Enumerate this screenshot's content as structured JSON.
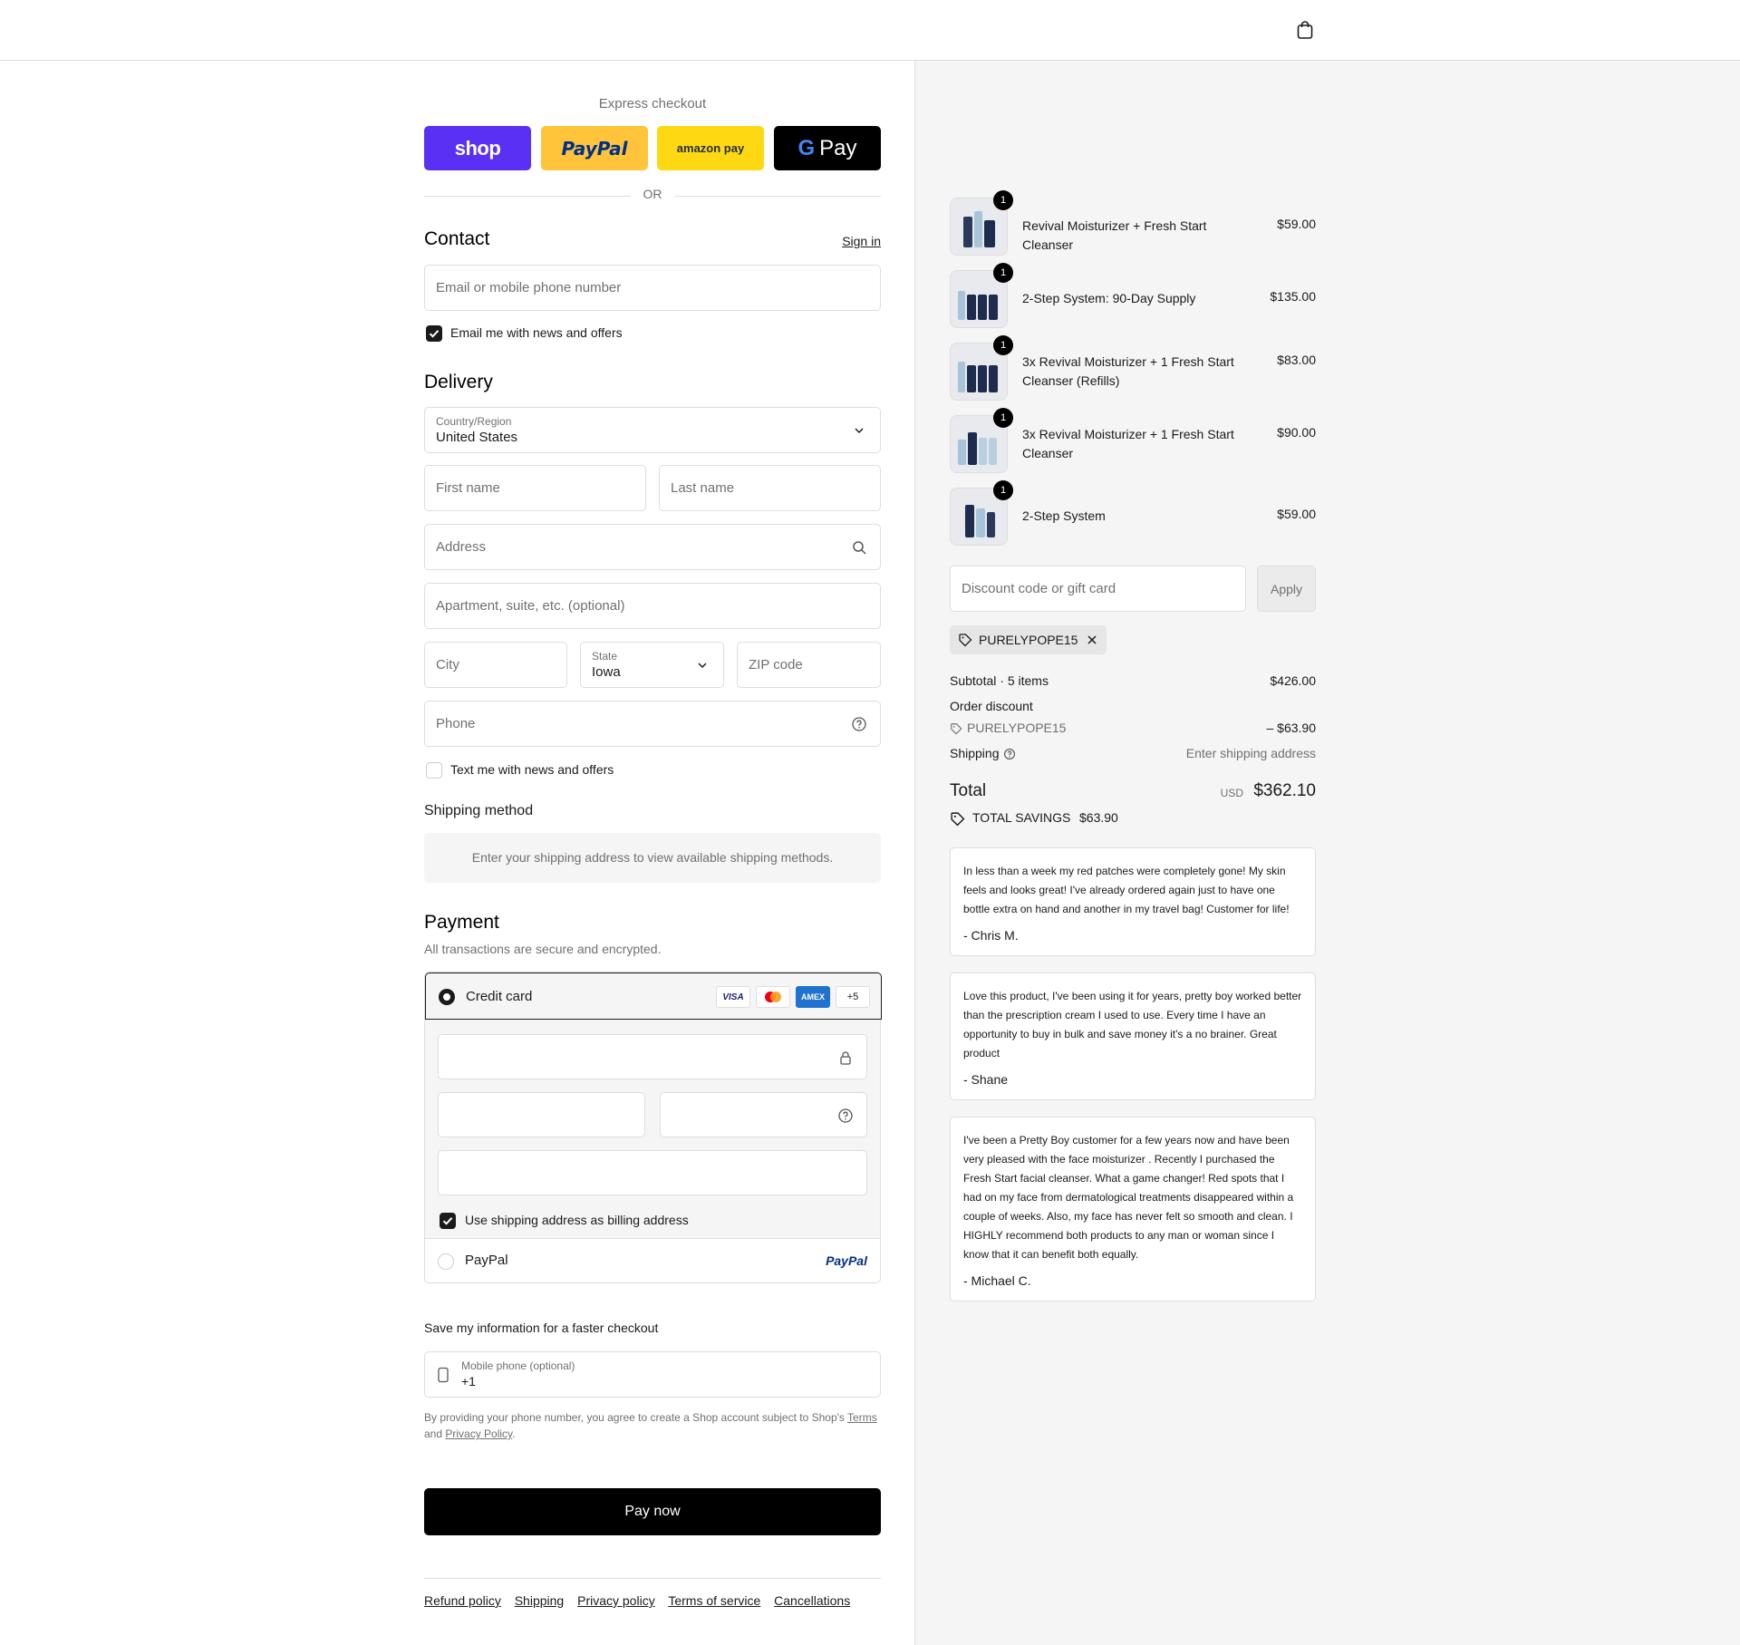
{
  "express": {
    "title": "Express checkout",
    "shop_label": "shop",
    "paypal_label": "PayPal",
    "amazon_label": "amazon pay",
    "gpay_label": "Pay",
    "or_label": "OR"
  },
  "contact": {
    "title": "Contact",
    "sign_in": "Sign in",
    "email_placeholder": "Email or mobile phone number",
    "news_label": "Email me with news and offers"
  },
  "delivery": {
    "title": "Delivery",
    "country_label": "Country/Region",
    "country_value": "United States",
    "first_name_placeholder": "First name",
    "last_name_placeholder": "Last name",
    "address_placeholder": "Address",
    "apartment_placeholder": "Apartment, suite, etc. (optional)",
    "city_placeholder": "City",
    "state_label": "State",
    "state_value": "Iowa",
    "zip_placeholder": "ZIP code",
    "phone_placeholder": "Phone",
    "text_label": "Text me with news and offers"
  },
  "shipping_method": {
    "title": "Shipping method",
    "message": "Enter your shipping address to view available shipping methods."
  },
  "payment": {
    "title": "Payment",
    "subtitle": "All transactions are secure and encrypted.",
    "credit_card_label": "Credit card",
    "card_brands": [
      "VISA",
      "MC",
      "AMEX",
      "+5"
    ],
    "billing_label": "Use shipping address as billing address",
    "paypal_label": "PayPal",
    "paypal_logo": "PayPal"
  },
  "save_info": {
    "title": "Save my information for a faster checkout",
    "mobile_label": "Mobile phone (optional)",
    "mobile_value": "+1",
    "legal_prefix": "By providing your phone number, you agree to create a Shop account subject to Shop's",
    "terms_link": "Terms",
    "legal_and": "and",
    "privacy_link": "Privacy Policy",
    "legal_end": "."
  },
  "pay_now": "Pay now",
  "footer_links": [
    "Refund policy",
    "Shipping",
    "Privacy policy",
    "Terms of service",
    "Cancellations"
  ],
  "order": {
    "items": [
      {
        "qty": "1",
        "name": "Revival Moisturizer + Fresh Start Cleanser",
        "price": "$59.00"
      },
      {
        "qty": "1",
        "name": "2-Step System: 90-Day Supply",
        "price": "$135.00"
      },
      {
        "qty": "1",
        "name": "3x Revival Moisturizer + 1 Fresh Start Cleanser (Refills)",
        "price": "$83.00"
      },
      {
        "qty": "1",
        "name": "3x Revival Moisturizer + 1 Fresh Start Cleanser",
        "price": "$90.00"
      },
      {
        "qty": "1",
        "name": "2-Step System",
        "price": "$59.00"
      }
    ],
    "discount_placeholder": "Discount code or gift card",
    "apply_label": "Apply",
    "applied_code": "PURELYPOPE15",
    "subtotal_label": "Subtotal · 5 items",
    "subtotal_value": "$426.00",
    "order_discount_label": "Order discount",
    "discount_code": "PURELYPOPE15",
    "discount_value": "– $63.90",
    "shipping_label": "Shipping",
    "shipping_value": "Enter shipping address",
    "total_label": "Total",
    "currency": "USD",
    "total_value": "$362.10",
    "savings_label": "TOTAL SAVINGS",
    "savings_value": "$63.90"
  },
  "reviews": [
    {
      "text": "In less than a week my red patches were completely gone! My skin feels and looks great! I've already ordered again just to have one bottle extra on hand and another in my travel bag! Customer for life!",
      "author": "- Chris M."
    },
    {
      "text": "Love this product, I've been using it for years, pretty boy worked better than the prescription cream I used to use. Every time I have an opportunity to buy in bulk and save money it's a no brainer. Great product",
      "author": "- Shane"
    },
    {
      "text": "I've been a Pretty Boy customer for a few years now and have been very pleased with the face moisturizer . Recently I purchased the Fresh Start facial cleanser. What a game changer! Red spots that I had on my face from dermatological treatments disappeared within a couple of weeks. Also, my face has never felt so smooth and clean. I HIGHLY recommend both products to any man or woman since I know that it can benefit both equally.",
      "author": "- Michael C."
    }
  ],
  "colors": {
    "shop_purple": "#5a31f4",
    "paypal_yellow": "#ffc439",
    "amazon_yellow": "#ffd814",
    "gpay_black": "#000000",
    "amex_blue": "#1f72cd",
    "paypal_blue": "#003087"
  }
}
